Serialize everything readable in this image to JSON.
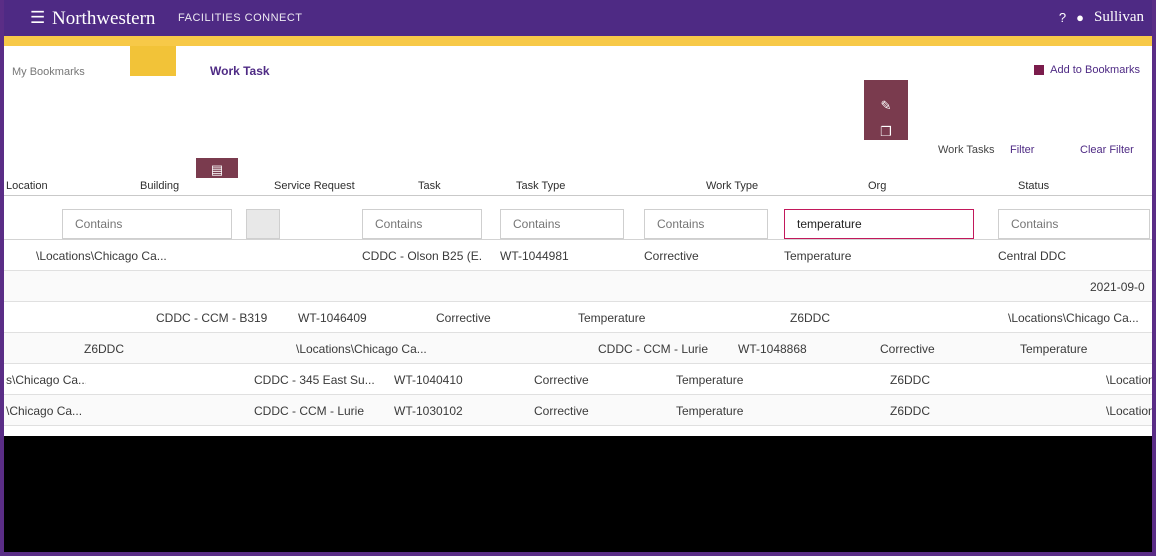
{
  "header": {
    "brand": "Northwestern",
    "brand_sub": "Facilities Connect",
    "user_name": "Sullivan",
    "menu_icon": "hamburger-icon",
    "help_icon": "question-icon",
    "user_icon": "person-icon"
  },
  "tabs": {
    "bookmarks": "My Bookmarks",
    "work_task": "Work Task",
    "add_bookmark": "Add to Bookmarks"
  },
  "toolbar": {
    "work_task_label": "Work Tasks",
    "filter_label": "Filter",
    "clear_filter": "Clear Filter"
  },
  "columns": [
    "Location",
    "Building",
    "Service Request",
    "Task",
    "Task Type",
    "Work Type",
    "Org",
    "Status"
  ],
  "filters": {
    "placeholder": "Contains",
    "active_value": "temperature"
  },
  "rows": [
    {
      "location": "\\Locations\\Chicago Ca...",
      "building": "CDDC - Olson B25 (E...",
      "task": "WT-1044981",
      "type": "Corrective",
      "work": "Temperature",
      "org": "Central DDC",
      "extra": ""
    },
    {
      "location": "",
      "building": "",
      "task": "",
      "type": "",
      "work": "",
      "org": "",
      "extra": "2021-09-0"
    },
    {
      "location": "",
      "building": "CDDC - CCM - B319",
      "task": "WT-1046409",
      "type": "Corrective",
      "work": "Temperature",
      "org": "Z6DDC",
      "extra": "\\Locations\\Chicago Ca..."
    },
    {
      "location": "Z6DDC",
      "building": "\\Locations\\Chicago Ca...",
      "task": "CDDC - CCM - Lurie",
      "type": "WT-1048868",
      "work": "Corrective",
      "org": "Temperature",
      "extra": ""
    },
    {
      "location": "s\\Chicago Ca...",
      "building": "CDDC - 345 East Su...",
      "task": "WT-1040410",
      "type": "Corrective",
      "work": "Temperature",
      "org": "Z6DDC",
      "extra": "\\Location"
    },
    {
      "location": "\\Chicago Ca...",
      "building": "CDDC - CCM - Lurie",
      "task": "WT-1030102",
      "type": "Corrective",
      "work": "Temperature",
      "org": "Z6DDC",
      "extra": "\\Location"
    }
  ],
  "colors": {
    "brand_purple": "#4e2a84",
    "accent_gold": "#f7c948",
    "action_maroon": "#7a3b4e",
    "filter_active": "#c2185b"
  }
}
